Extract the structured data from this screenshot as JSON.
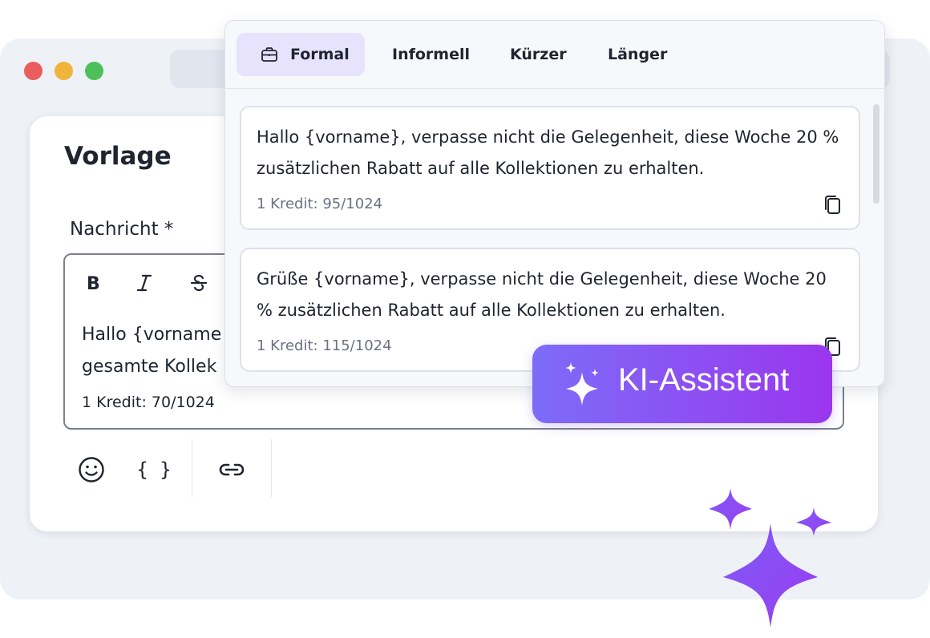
{
  "window": {
    "traffic_lights": [
      "#e95d5d",
      "#f0b43c",
      "#4dc05a"
    ]
  },
  "template": {
    "title": "Vorlage",
    "field_label": "Nachricht *",
    "editor_text_line1": "Hallo {vorname",
    "editor_text_line2": "gesamte Kollek",
    "counter": "1 Kredit: 70/1024"
  },
  "toolbar": {
    "bold_icon": "bold-icon",
    "italic_icon": "italic-icon",
    "strike_icon": "strikethrough-icon",
    "braces_label": "{ }"
  },
  "popup": {
    "tabs": [
      {
        "label": "Formal",
        "icon": "briefcase-icon",
        "active": true
      },
      {
        "label": "Informell"
      },
      {
        "label": "Kürzer"
      },
      {
        "label": "Länger"
      }
    ],
    "suggestions": [
      {
        "text": "Hallo {vorname}, verpasse nicht die Gelegenheit, diese Woche 20 % zusätzlichen Rabatt auf alle Kollektionen zu erhalten.",
        "meta": "1 Kredit: 95/1024"
      },
      {
        "text": "Grüße {vorname}, verpasse nicht die Gelegenheit, diese Woche 20 % zusätzlichen Rabatt auf alle Kollektionen zu erhalten.",
        "meta": "1 Kredit: 115/1024"
      }
    ]
  },
  "ai_button": {
    "label": "KI-Assistent",
    "icon": "sparkle-icon"
  },
  "colors": {
    "accent": "#8a4ff2",
    "accent_start": "#7d6cf8",
    "active_tab_bg": "#e8e3fd"
  }
}
